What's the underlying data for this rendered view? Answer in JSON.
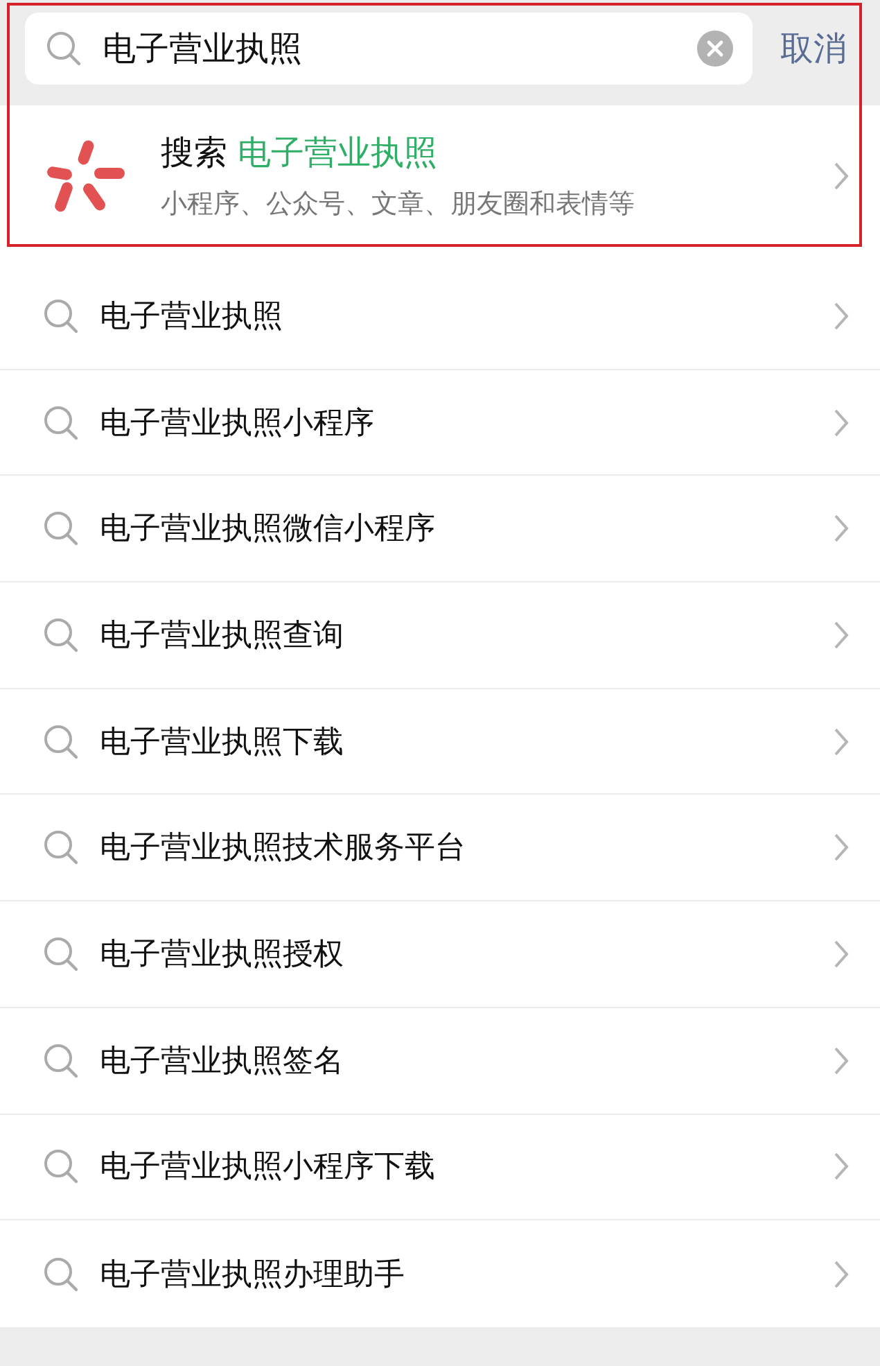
{
  "search_bar": {
    "query": "电子营业执照",
    "cancel": "取消"
  },
  "search_all": {
    "label": "搜索",
    "keyword": "电子营业执照",
    "subtitle": "小程序、公众号、文章、朋友圈和表情等"
  },
  "suggestions": [
    "电子营业执照",
    "电子营业执照小程序",
    "电子营业执照微信小程序",
    "电子营业执照查询",
    "电子营业执照下载",
    "电子营业执照技术服务平台",
    "电子营业执照授权",
    "电子营业执照签名",
    "电子营业执照小程序下载",
    "电子营业执照办理助手"
  ]
}
